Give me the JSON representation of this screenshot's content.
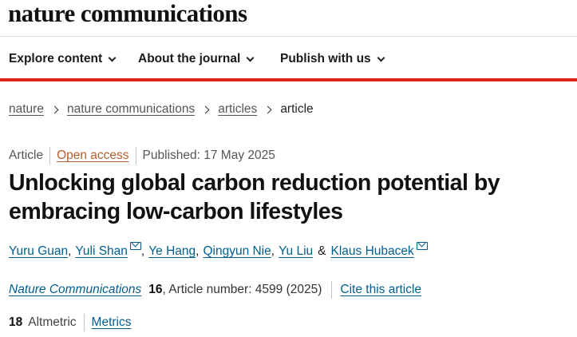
{
  "header": {
    "logo": "nature communications"
  },
  "nav": {
    "items": [
      {
        "label": "Explore content"
      },
      {
        "label": "About the journal"
      },
      {
        "label": "Publish with us"
      }
    ]
  },
  "breadcrumb": {
    "items": [
      "nature",
      "nature communications",
      "articles"
    ],
    "current": "article"
  },
  "article": {
    "type": "Article",
    "access": "Open access",
    "published": "Published: 17 May 2025",
    "title": "Unlocking global carbon reduction potential by embracing low-carbon lifestyles",
    "authors": [
      "Yuru Guan",
      "Yuli Shan",
      "Ye Hang",
      "Qingyun Nie",
      "Yu Liu",
      "Klaus Hubacek"
    ],
    "amp": "&",
    "journal": "Nature Communications",
    "volume": "16",
    "article_number": ", Article number: 4599 (2025)",
    "cite": "Cite this article",
    "altmetric_count": "18",
    "altmetric_label": "Altmetric",
    "metrics": "Metrics"
  }
}
